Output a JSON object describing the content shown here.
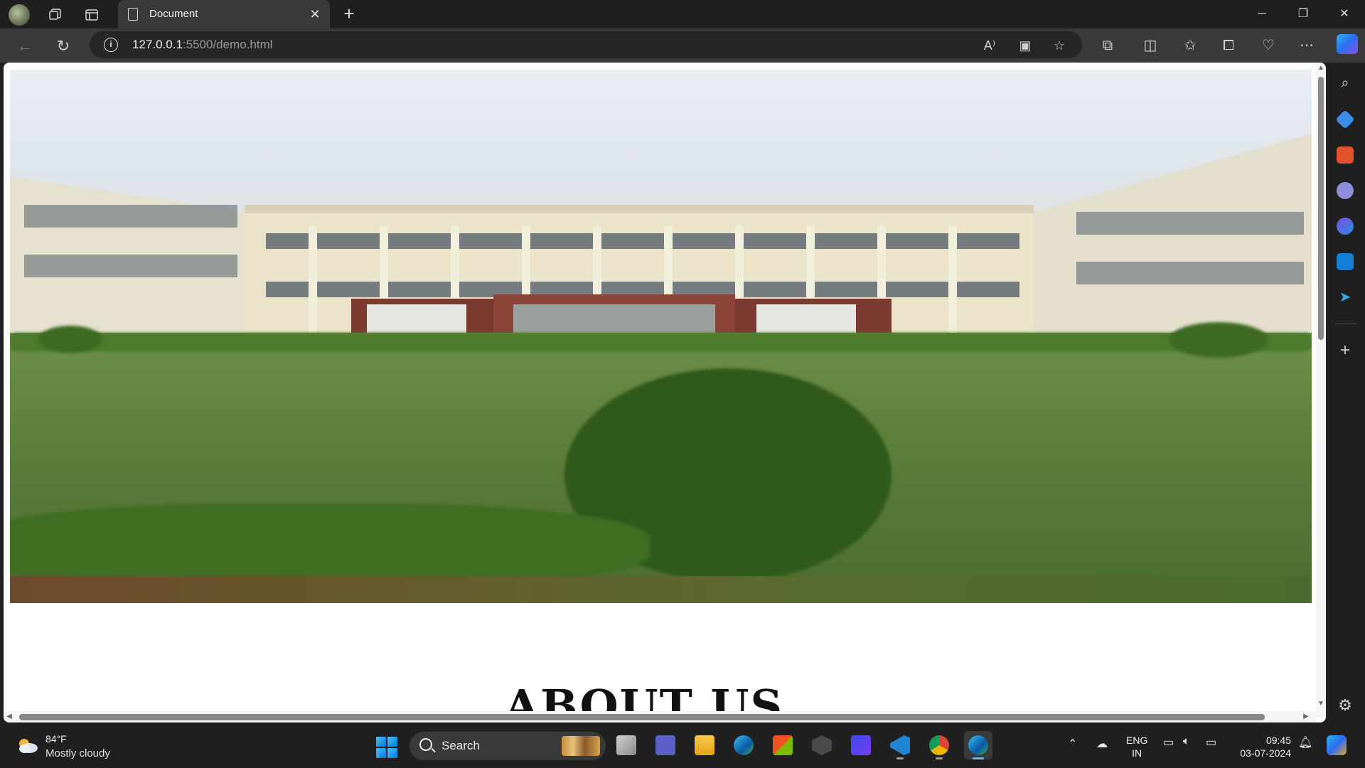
{
  "browser": {
    "tab_title": "Document",
    "url_host": "127.0.0.1",
    "url_rest": ":5500/demo.html"
  },
  "page": {
    "heading": "ABOUT US"
  },
  "taskbar": {
    "weather_temp": "84°F",
    "weather_desc": "Mostly cloudy",
    "search_label": "Search",
    "lang_line1": "ENG",
    "lang_line2": "IN",
    "time": "09:45",
    "date": "03-07-2024"
  },
  "icons": {
    "back": "arrow-left-icon",
    "refresh": "refresh-icon",
    "info": "info-icon",
    "read_aloud": "read-aloud-icon",
    "immersive": "immersive-reader-icon",
    "favorite": "star-icon",
    "extensions": "puzzle-icon",
    "split": "split-screen-icon",
    "favorites": "favorites-icon",
    "collections": "collections-icon",
    "health": "browser-essentials-icon",
    "more": "more-icon"
  },
  "colors": {
    "accent": "#4cc2ff",
    "chrome_dark": "#1f1f1f",
    "chrome_mid": "#3a3a3a"
  }
}
